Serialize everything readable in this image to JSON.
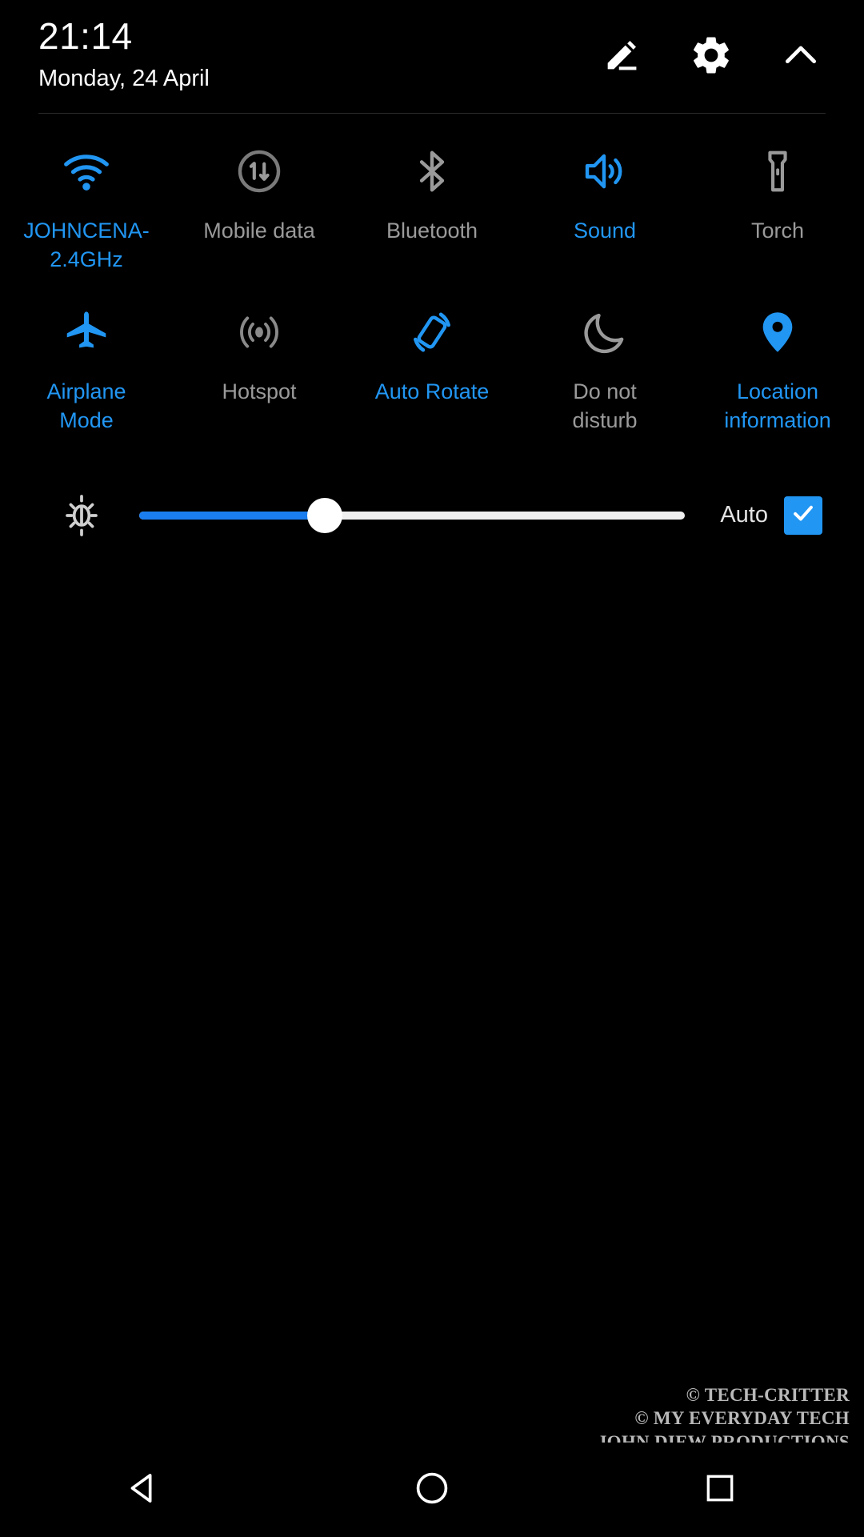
{
  "status": {
    "time": "21:14",
    "date": "Monday, 24 April"
  },
  "header_actions": [
    {
      "name": "edit-icon",
      "label": "Edit"
    },
    {
      "name": "gear-icon",
      "label": "Settings"
    },
    {
      "name": "chevron-up-icon",
      "label": "Collapse"
    }
  ],
  "colors": {
    "accent": "#2196f3",
    "inactive": "#9a9a9a",
    "slider_fill": "#1a7ef0",
    "slider_track": "#f0f0f0",
    "background": "#000000"
  },
  "tiles": {
    "row1": [
      {
        "label": "JOHNCENA-2.4GHz",
        "icon": "wifi-icon",
        "state": "on"
      },
      {
        "label": "Mobile data",
        "icon": "mobile-data-icon",
        "state": "off"
      },
      {
        "label": "Bluetooth",
        "icon": "bluetooth-icon",
        "state": "off"
      },
      {
        "label": "Sound",
        "icon": "sound-icon",
        "state": "on"
      },
      {
        "label": "Torch",
        "icon": "torch-icon",
        "state": "off"
      }
    ],
    "row2": [
      {
        "label": "Airplane Mode",
        "icon": "airplane-icon",
        "state": "on"
      },
      {
        "label": "Hotspot",
        "icon": "hotspot-icon",
        "state": "off"
      },
      {
        "label": "Auto Rotate",
        "icon": "auto-rotate-icon",
        "state": "on"
      },
      {
        "label": "Do not disturb",
        "icon": "moon-icon",
        "state": "off"
      },
      {
        "label": "Location information",
        "icon": "location-pin-icon",
        "state": "on"
      }
    ]
  },
  "brightness": {
    "icon": "brightness-icon",
    "value_percent": 34,
    "auto_label": "Auto",
    "auto_checked": true,
    "check_glyph": "check-icon"
  },
  "watermark": {
    "line1": "© TECH-CRITTER",
    "line2": "© MY EVERYDAY TECH",
    "line3": "JOHN DIEW PRODUCTIONS"
  },
  "navbar": [
    {
      "name": "back-button",
      "icon": "triangle-left-icon"
    },
    {
      "name": "home-button",
      "icon": "circle-icon"
    },
    {
      "name": "recents-button",
      "icon": "square-icon"
    }
  ]
}
